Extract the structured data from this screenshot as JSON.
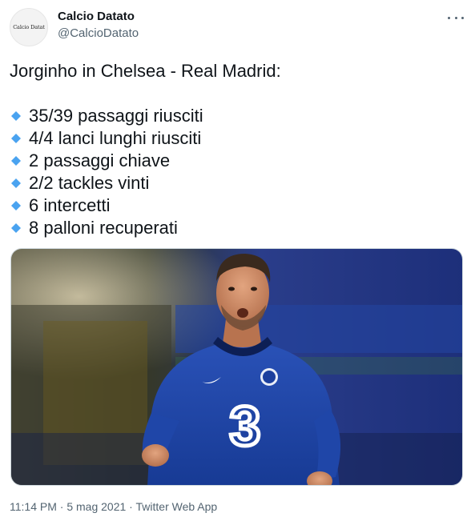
{
  "author": {
    "avatar_text": "Calcio Datat",
    "display_name": "Calcio Datato",
    "handle": "@CalcioDatato"
  },
  "tweet": {
    "headline": "Jorginho in Chelsea - Real Madrid:",
    "bullet_icon": "small-blue-diamond-icon",
    "bullet_color": "#4aa3f0",
    "stats": [
      "35/39 passaggi riusciti",
      "4/4 lanci lunghi riusciti",
      "2 passaggi chiave",
      "2/2 tackles vinti",
      "6 intercetti",
      "8 palloni recuperati"
    ],
    "media_description_icon": "player-photo",
    "jersey_sponsor": "3"
  },
  "meta": {
    "time": "11:14 PM",
    "separator": " · ",
    "date": "5 mag 2021",
    "source": "Twitter Web App"
  },
  "colors": {
    "text": "#0f1419",
    "secondary": "#536471",
    "jersey": "#1c3f9e"
  }
}
